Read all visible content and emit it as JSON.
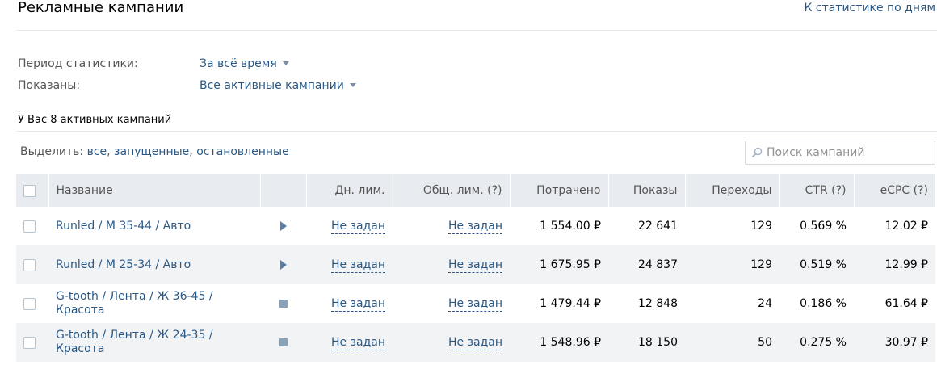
{
  "header": {
    "title": "Рекламные кампании",
    "stats_link": "К статистике по дням"
  },
  "filters": {
    "period_label": "Период статистики:",
    "period_value": "За всё время",
    "shown_label": "Показаны:",
    "shown_value": "Все активные кампании"
  },
  "summary": "У Вас 8 активных кампаний",
  "select": {
    "label": "Выделить:",
    "all": "все",
    "running": "запущенные",
    "stopped": "остановленные"
  },
  "search": {
    "placeholder": "Поиск кампаний"
  },
  "table": {
    "columns": [
      "Название",
      "Дн. лим.",
      "Общ. лим. (?)",
      "Потрачено",
      "Показы",
      "Переходы",
      "CTR (?)",
      "eCPC (?)"
    ],
    "rows": [
      {
        "name_line1": "Runled / М 35-44 / Авто",
        "name_line2": "",
        "status": "play-icon",
        "day_limit": "Не задан",
        "total_limit": "Не задан",
        "spent": "1 554.00 ₽",
        "impressions": "22 641",
        "clicks": "129",
        "ctr": "0.569 %",
        "ecpc": "12.02 ₽"
      },
      {
        "name_line1": "Runled / М 25-34 / Авто",
        "name_line2": "",
        "status": "play-icon",
        "day_limit": "Не задан",
        "total_limit": "Не задан",
        "spent": "1 675.95 ₽",
        "impressions": "24 837",
        "clicks": "129",
        "ctr": "0.519 %",
        "ecpc": "12.99 ₽"
      },
      {
        "name_line1": "G-tooth / Лента / Ж 36-45 /",
        "name_line2": "Красота",
        "status": "stop-icon",
        "day_limit": "Не задан",
        "total_limit": "Не задан",
        "spent": "1 479.44 ₽",
        "impressions": "12 848",
        "clicks": "24",
        "ctr": "0.186 %",
        "ecpc": "61.64 ₽"
      },
      {
        "name_line1": "G-tooth / Лента / Ж 24-35 /",
        "name_line2": "Красота",
        "status": "stop-icon",
        "day_limit": "Не задан",
        "total_limit": "Не задан",
        "spent": "1 548.96 ₽",
        "impressions": "18 150",
        "clicks": "50",
        "ctr": "0.275 %",
        "ecpc": "30.97 ₽"
      }
    ]
  }
}
